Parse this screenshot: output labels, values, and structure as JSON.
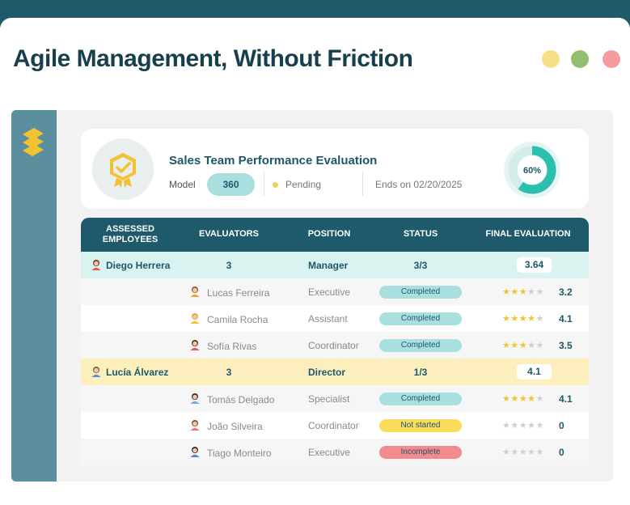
{
  "page": {
    "title": "Agile Management, Without Friction",
    "window_dots": [
      "#f8df8a",
      "#92bf6f",
      "#f59c9c"
    ]
  },
  "evaluation": {
    "title": "Sales Team Performance Evaluation",
    "model_label": "Model",
    "model_value": "360",
    "status": "Pending",
    "ends": "Ends on 02/20/2025",
    "progress_label": "60%",
    "progress": 0.6
  },
  "table": {
    "headers": {
      "assessed": "ASSESSED\nEMPLOYEES",
      "evaluators": "EVALUATORS",
      "position": "POSITION",
      "status": "STATUS",
      "final": "FINAL EVALUATION"
    },
    "groups": [
      {
        "employee": "Diego Herrera",
        "evaluators": "3",
        "position": "Manager",
        "status": "3/3",
        "final": "3.64",
        "evaluations": [
          {
            "name": "Lucas Ferreira",
            "position": "Executive",
            "status": "Completed",
            "stars": 3,
            "score": "3.2"
          },
          {
            "name": "Camila Rocha",
            "position": "Assistant",
            "status": "Completed",
            "stars": 4,
            "score": "4.1"
          },
          {
            "name": "Sofía Rivas",
            "position": "Coordinator",
            "status": "Completed",
            "stars": 3,
            "score": "3.5"
          }
        ]
      },
      {
        "employee": "Lucía Álvarez",
        "evaluators": "3",
        "position": "Director",
        "status": "1/3",
        "final": "4.1",
        "evaluations": [
          {
            "name": "Tomás Delgado",
            "position": "Specialist",
            "status": "Completed",
            "stars": 4,
            "score": "4.1"
          },
          {
            "name": "João Silveira",
            "position": "Coordinator",
            "status": "Not started",
            "stars": 0,
            "score": "0"
          },
          {
            "name": "Tiago Monteiro",
            "position": "Executive",
            "status": "Incomplete",
            "stars": 0,
            "score": "0"
          }
        ]
      }
    ]
  },
  "colors": {
    "completed": "#a9e0df",
    "not_started": "#f9dc5c",
    "incomplete": "#f38b8e",
    "group_1": "#d9f3f1",
    "group_2": "#fcefbd"
  }
}
